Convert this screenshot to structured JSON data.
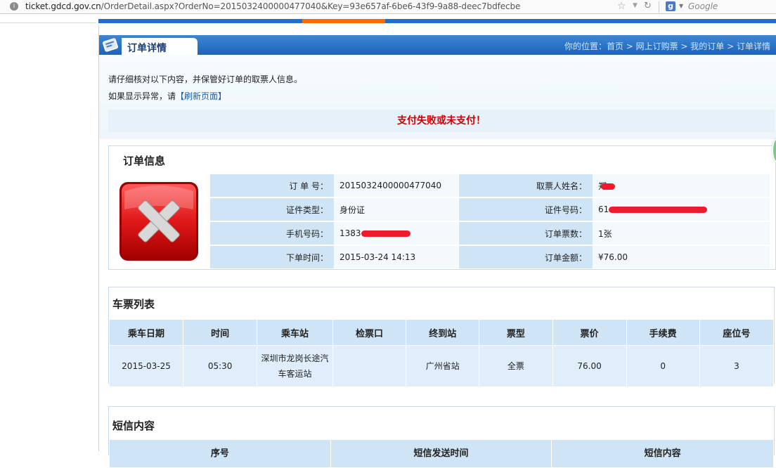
{
  "browser": {
    "url_host": "ticket.gdcd.gov.cn",
    "url_path": "/OrderDetail.aspx?OrderNo=2015032400000477040&Key=93e657af-6be6-43f9-9a88-deec7bdfecbe",
    "search_placeholder": "Google"
  },
  "page": {
    "title": "订单详情",
    "breadcrumb": "你的位置：首页 > 网上订购票 > 我的订单 > 订单详情",
    "intro_line1": "请仔细核对以下内容，并保管好订单的取票人信息。",
    "intro_line2_prefix": "如果显示异常，请",
    "refresh_link": "【刷新页面】",
    "status": "支付失败或未支付！"
  },
  "order_info": {
    "heading": "订单信息",
    "labels": {
      "order_no": "订 单 号：",
      "pickup_name": "取票人姓名：",
      "id_type": "证件类型：",
      "id_no": "证件号码：",
      "phone": "手机号码：",
      "ticket_count": "订单票数：",
      "order_time": "下单时间：",
      "amount": "订单金额："
    },
    "values": {
      "order_no": "2015032400000477040",
      "pickup_name": "郑",
      "id_type": "身份证",
      "id_no": "61",
      "phone": "1383",
      "ticket_count": "1张",
      "order_time": "2015-03-24 14:13",
      "amount": "¥76.00"
    },
    "status_icon": "error-x-icon"
  },
  "ticket_list": {
    "heading": "车票列表",
    "columns": [
      "乘车日期",
      "时间",
      "乘车站",
      "检票口",
      "终到站",
      "票型",
      "票价",
      "手续费",
      "座位号"
    ],
    "rows": [
      [
        "2015-03-25",
        "05:30",
        "深圳市龙岗长途汽车客运站",
        "",
        "广州省站",
        "全票",
        "76.00",
        "0",
        "3"
      ]
    ]
  },
  "sms": {
    "heading": "短信内容",
    "columns": [
      "序号",
      "短信发送时间",
      "短信内容"
    ]
  },
  "colors": {
    "title_bar": "#1f63b5",
    "status_text": "#cc0000",
    "header_cell": "#cfe5f6",
    "nav_accent": "#ff6a00"
  }
}
